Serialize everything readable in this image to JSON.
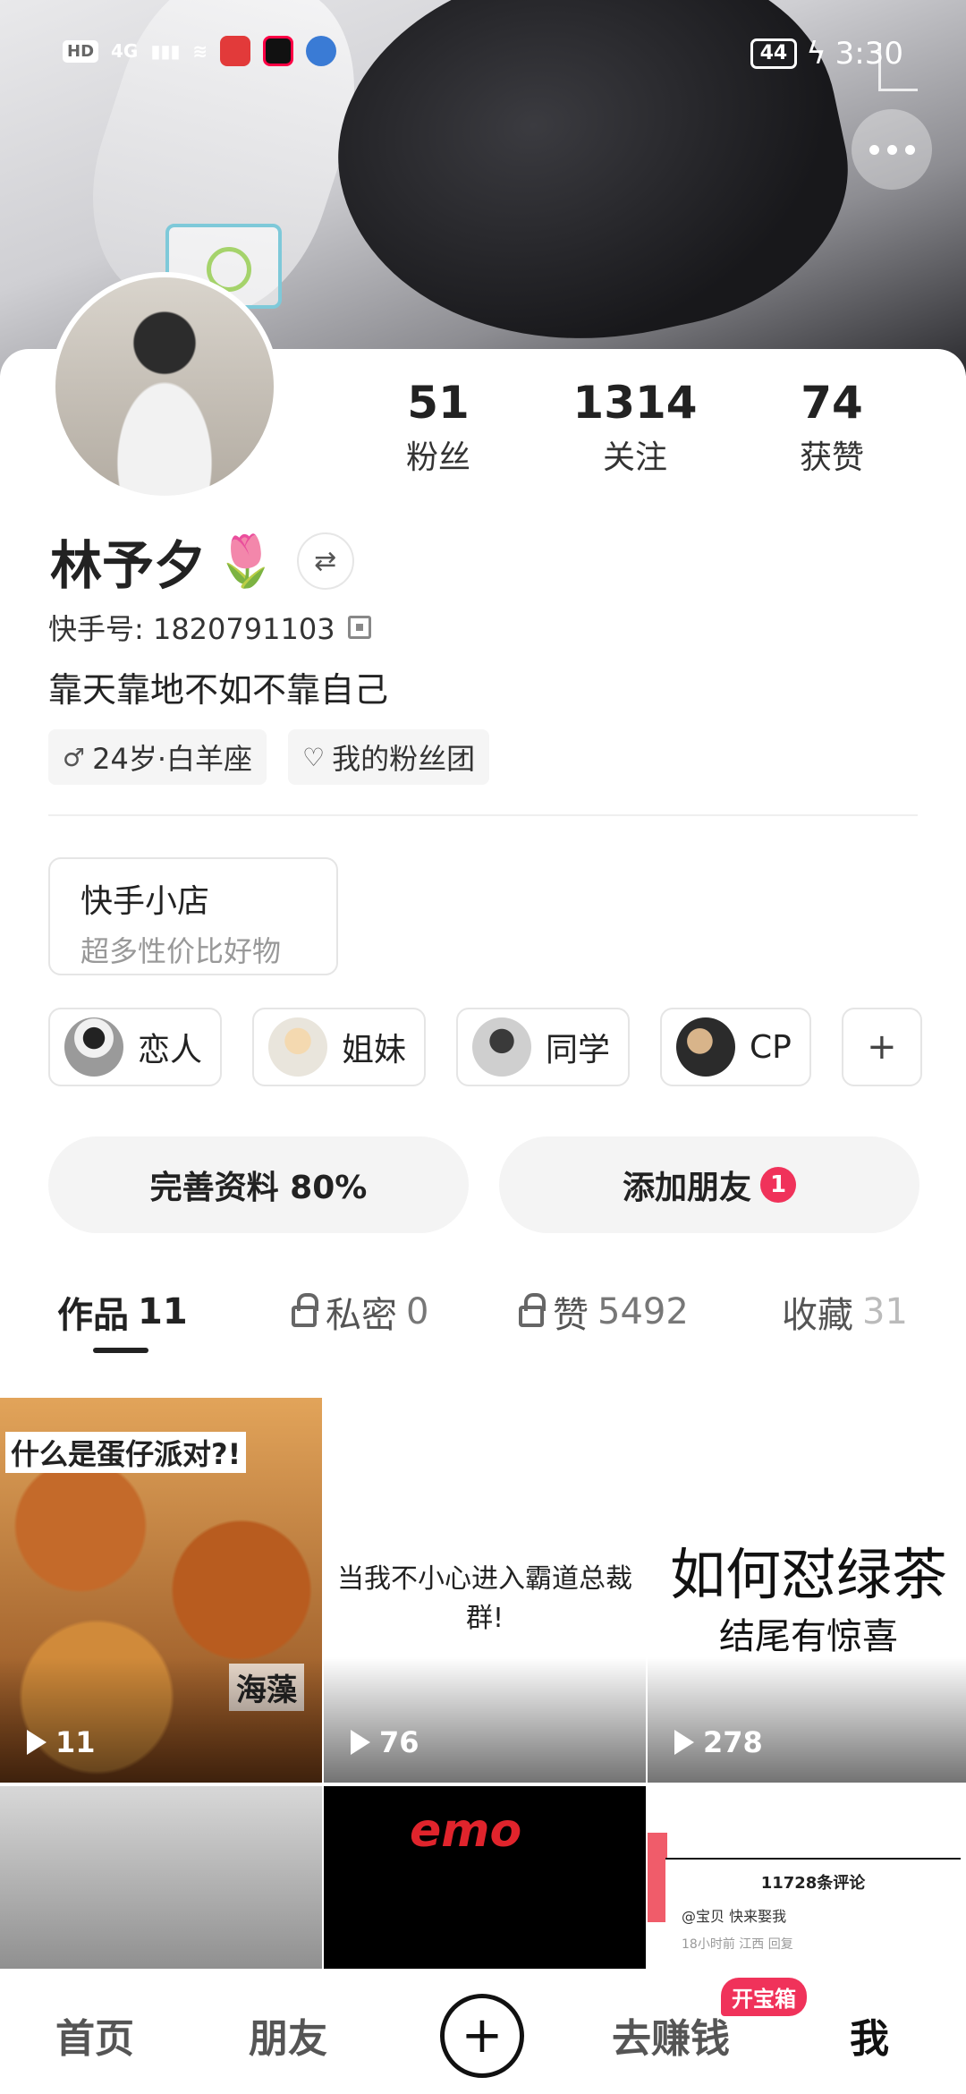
{
  "status_bar": {
    "left_items": [
      "HD",
      "4G"
    ],
    "battery": "44",
    "time": "3:30"
  },
  "profile": {
    "name": "林予夕",
    "name_emoji": "🌷",
    "kuaishou_id": "快手号: 1820791103",
    "bio": "靠天靠地不如不靠自己",
    "stats": [
      {
        "num": "51",
        "label": "粉丝"
      },
      {
        "num": "1314",
        "label": "关注"
      },
      {
        "num": "74",
        "label": "获赞"
      }
    ],
    "tags": [
      {
        "icon": "♂",
        "text": "24岁·白羊座"
      },
      {
        "icon": "♡",
        "text": "我的粉丝团"
      }
    ]
  },
  "shop": {
    "title": "快手小店",
    "subtitle": "超多性价比好物"
  },
  "relations": [
    {
      "label": "恋人"
    },
    {
      "label": "姐妹"
    },
    {
      "label": "同学"
    },
    {
      "label": "CP"
    }
  ],
  "relations_add": "+",
  "actions": {
    "complete_profile": "完善资料 80%",
    "add_friend": "添加朋友",
    "add_friend_badge": "1"
  },
  "tabs": [
    {
      "label": "作品",
      "count": "11"
    },
    {
      "label": "私密",
      "count": "0"
    },
    {
      "label": "赞",
      "count": "5492"
    },
    {
      "label": "收藏",
      "count": "31"
    }
  ],
  "videos": [
    {
      "title": "什么是蛋仔派对?!",
      "corner": "海藻",
      "plays": "11"
    },
    {
      "title": "当我不小心进入霸道总裁群!",
      "plays": "76"
    },
    {
      "title": "如何怼绿茶",
      "subtitle": "结尾有惊喜",
      "plays": "278"
    },
    {
      "title": ""
    },
    {
      "title": "emo"
    },
    {
      "comments_header": "11728条评论",
      "comment": "@宝贝  快来娶我",
      "meta": "18小时前 江西    回复"
    }
  ],
  "bottom_nav": {
    "home": "首页",
    "friends": "朋友",
    "earn": "去赚钱",
    "earn_badge": "开宝箱",
    "me": "我"
  }
}
